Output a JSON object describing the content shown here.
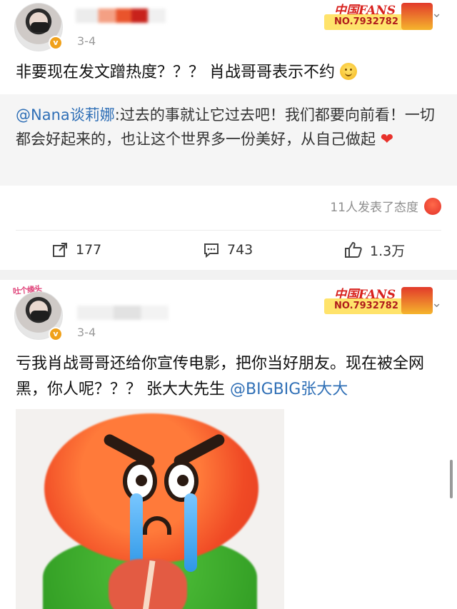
{
  "colors": {
    "mention": "#2f6fb6",
    "time": "#9a9a9a",
    "heart": "#e8312b",
    "fans_red": "#d8221e",
    "separator": "#f2f2f2"
  },
  "post1": {
    "time": "3-4",
    "fans_badge": {
      "logo": "中国FANS",
      "number": "NO.7932782"
    },
    "text": "非要现在发文蹭热度？？？ 肖战哥哥表示不约",
    "emoji": "smile-emoji",
    "repost": {
      "mention": "@Nana谈莉娜",
      "text": ":过去的事就让它过去吧！我们都要向前看！一切都会好起来的，也让这个世界多一份美好，从自己做起",
      "emoji": "heart-emoji"
    },
    "reactions_text": "11人发表了态度",
    "actions": {
      "repost": "177",
      "comment": "743",
      "like": "1.3万"
    }
  },
  "post2": {
    "time": "3-4",
    "avatar_tag": "吐个缘头",
    "fans_badge": {
      "logo": "中国FANS",
      "number": "NO.7932782"
    },
    "text_part1": "亏我肖战哥哥还给你宣传电影，把你当好朋友。现在被全网黑，你人呢？？？ 张大大先生 ",
    "mention": "@BIGBIG张大大",
    "image": "crying-angry-emoji-sticker"
  }
}
